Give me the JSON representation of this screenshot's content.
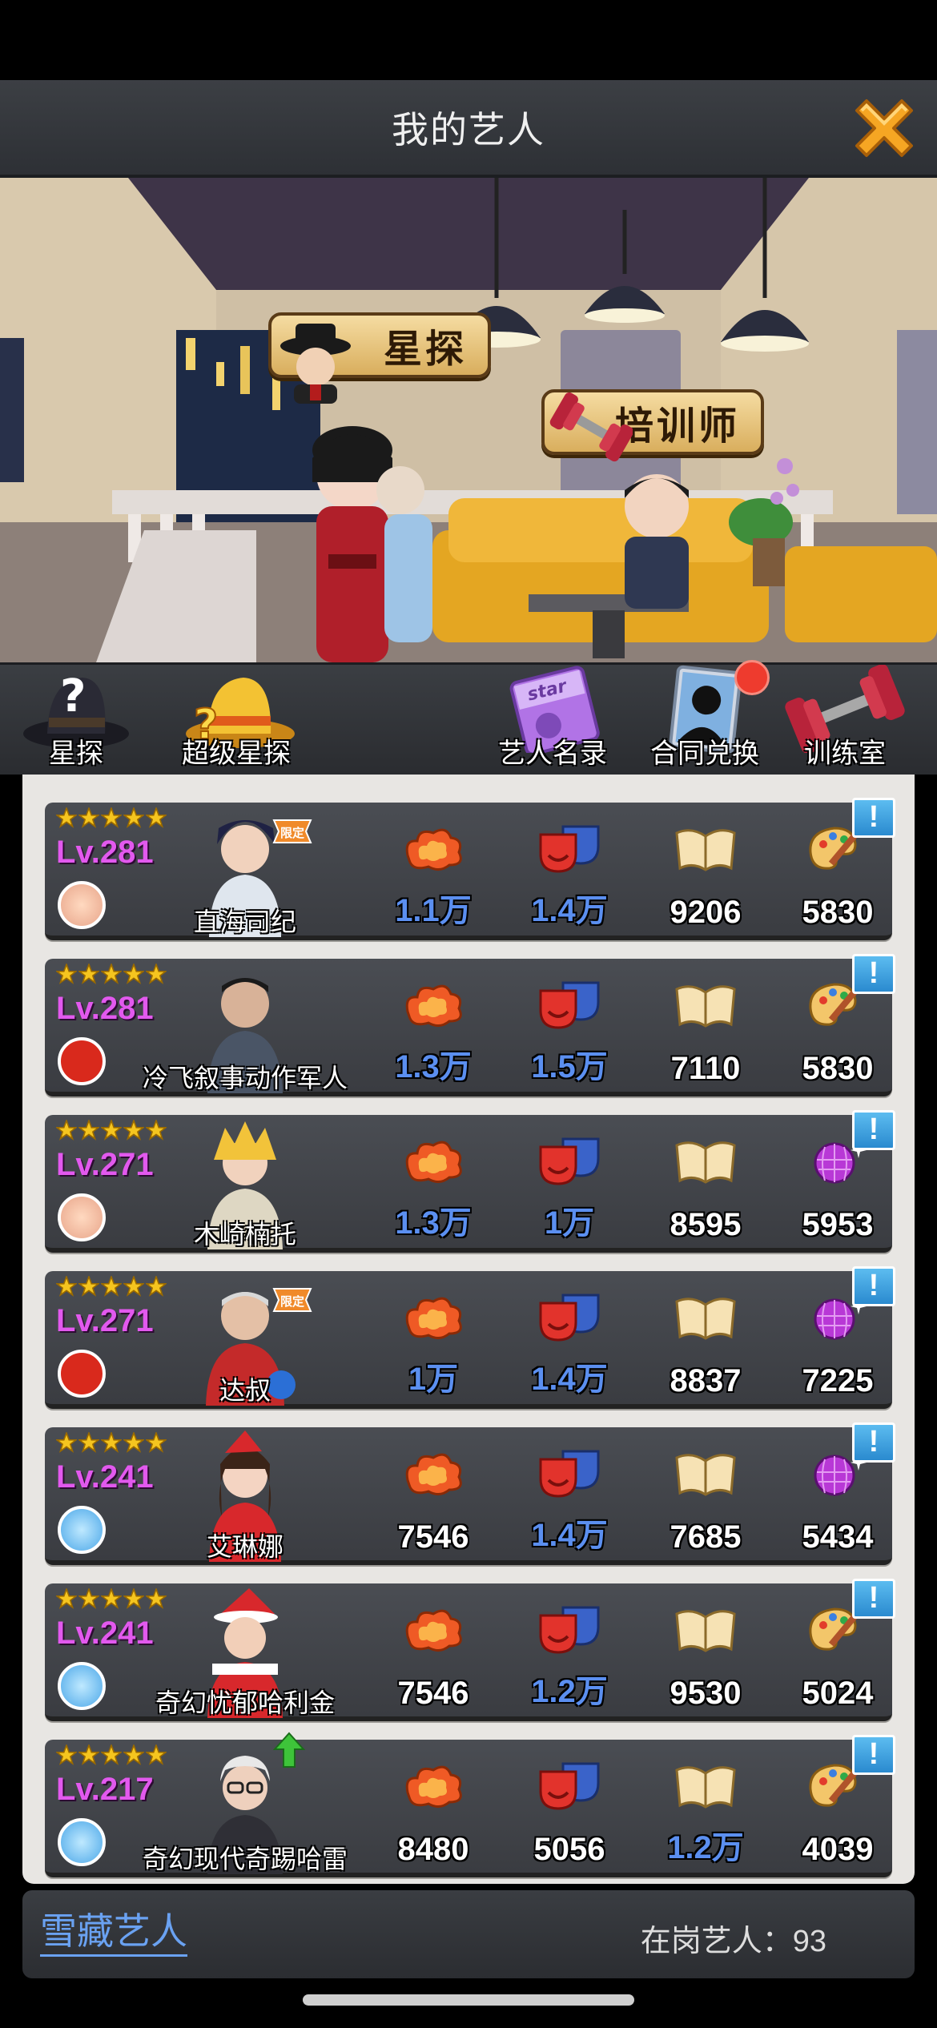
{
  "header": {
    "title": "我的艺人"
  },
  "scene": {
    "tags": [
      "星探",
      "培训师"
    ]
  },
  "menu": [
    {
      "label": "星探",
      "icon": "scout-hat-icon"
    },
    {
      "label": "超级星探",
      "icon": "gold-hat-icon"
    },
    {
      "label": "艺人名录",
      "icon": "star-book-icon"
    },
    {
      "label": "合同兑换",
      "icon": "contract-silhouette-icon",
      "notification": true
    },
    {
      "label": "训练室",
      "icon": "dumbbell-icon"
    }
  ],
  "artists": [
    {
      "name": "直海司纪",
      "level": "Lv.281",
      "stars": 5,
      "badge": "flower",
      "limited": true,
      "acting": "1.1万",
      "performance": "1.4万",
      "knowledge": "9206",
      "art": "5830",
      "art_icon": "palette"
    },
    {
      "name": "冷飞叙事动作军人",
      "level": "Lv.281",
      "stars": 5,
      "badge": "china",
      "limited": false,
      "acting": "1.3万",
      "performance": "1.5万",
      "knowledge": "7110",
      "art": "5830",
      "art_icon": "palette"
    },
    {
      "name": "木崎楠托",
      "level": "Lv.271",
      "stars": 5,
      "badge": "flower",
      "limited": false,
      "acting": "1.3万",
      "performance": "1万",
      "knowledge": "8595",
      "art": "5953",
      "art_icon": "disco"
    },
    {
      "name": "达叔",
      "level": "Lv.271",
      "stars": 5,
      "badge": "china",
      "limited": true,
      "acting": "1万",
      "performance": "1.4万",
      "knowledge": "8837",
      "art": "7225",
      "art_icon": "disco"
    },
    {
      "name": "艾琳娜",
      "level": "Lv.241",
      "stars": 5,
      "badge": "blue",
      "limited": false,
      "acting": "7546",
      "performance": "1.4万",
      "knowledge": "7685",
      "art": "5434",
      "art_icon": "disco"
    },
    {
      "name": "奇幻忧郁哈利金",
      "level": "Lv.241",
      "stars": 5,
      "badge": "blue",
      "limited": false,
      "acting": "7546",
      "performance": "1.2万",
      "knowledge": "9530",
      "art": "5024",
      "art_icon": "palette"
    },
    {
      "name": "奇幻现代奇踢哈雷",
      "level": "Lv.217",
      "stars": 5,
      "badge": "blue",
      "limited": false,
      "upgrade": true,
      "acting": "8480",
      "performance": "5056",
      "knowledge": "1.2万",
      "art": "4039",
      "art_icon": "palette"
    }
  ],
  "footer": {
    "link": "雪藏艺人",
    "count_label": "在岗艺人：93"
  },
  "colors": {
    "level": "#e259ee",
    "stat_blue": "#5b8ff0",
    "accent_orange": "#f6a623"
  }
}
